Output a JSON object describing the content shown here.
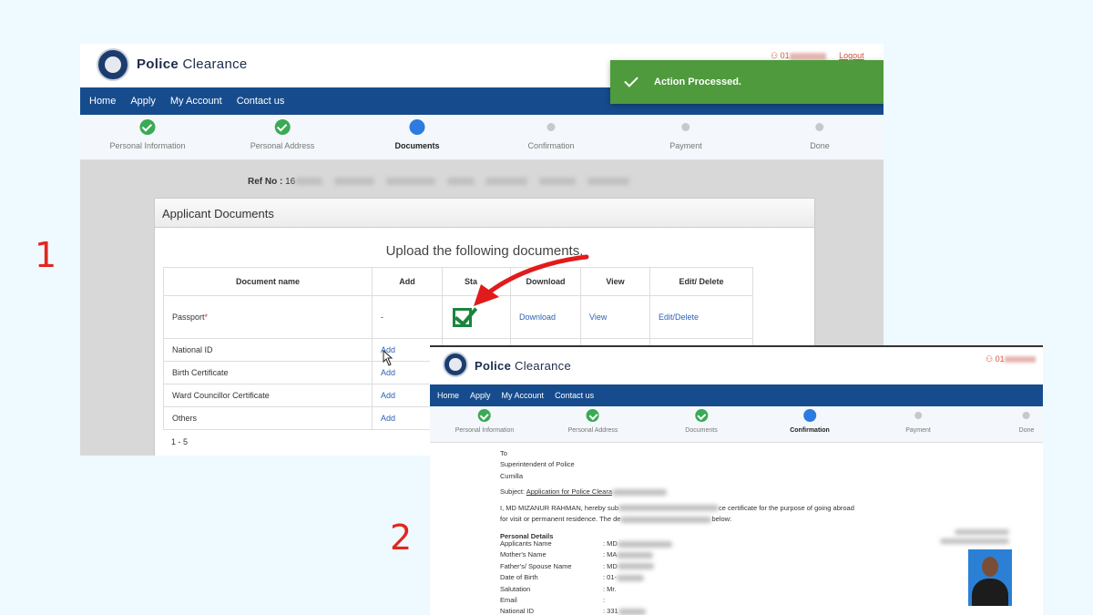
{
  "labels": {
    "one": "1",
    "two": "2"
  },
  "shot1": {
    "brand_bold": "Police",
    "brand_rest": " Clearance",
    "user_prefix": "01",
    "logout": "Logout",
    "nav": [
      "Home",
      "Apply",
      "My Account",
      "Contact us"
    ],
    "steps": [
      "Personal Information",
      "Personal Address",
      "Documents",
      "Confirmation",
      "Payment",
      "Done"
    ],
    "toast": "Action Processed.",
    "ref_label": "Ref No :",
    "ref_value": "16",
    "panel_title": "Applicant Documents",
    "upload_title": "Upload the following documents.",
    "headers": [
      "Document name",
      "Add",
      "Status",
      "Download",
      "View",
      "Edit/ Delete"
    ],
    "header_status_visible": "Sta",
    "rows": [
      {
        "name": "Passport",
        "required": "*",
        "add": "-",
        "download": "Download",
        "view": "View",
        "edit": "Edit/Delete"
      },
      {
        "name": "National ID",
        "add": "Add"
      },
      {
        "name": "Birth Certificate",
        "add": "Add"
      },
      {
        "name": "Ward Councillor Certificate",
        "add": "Add"
      },
      {
        "name": "Others",
        "add": "Add"
      }
    ],
    "pager": "1 - 5"
  },
  "shot2": {
    "brand_bold": "Police",
    "brand_rest": " Clearance",
    "user_prefix": "01",
    "nav": [
      "Home",
      "Apply",
      "My Account",
      "Contact us"
    ],
    "steps": [
      "Personal Information",
      "Personal Address",
      "Documents",
      "Confirmation",
      "Payment",
      "Done"
    ],
    "to": "To",
    "addressee": "Superintendent of Police",
    "district": "Cumilla",
    "subject_label": "Subject:",
    "subject_value": "Application for Police Cleara",
    "body_line1_a": "I, MD MIZANUR RAHMAN, hereby sub",
    "body_line1_b": "ce certificate for the purpose of going abroad",
    "body_line2_a": "for visit or permanent residence. The de",
    "body_line2_b": "below:",
    "section": "Personal Details",
    "fields": [
      {
        "label": "Applicants Name",
        "value": "MD"
      },
      {
        "label": "Mother's Name",
        "value": "MA"
      },
      {
        "label": "Father's/ Spouse Name",
        "value": "MD"
      },
      {
        "label": "Date of Birth",
        "value": "01-"
      },
      {
        "label": "Salutation",
        "value": "Mr."
      },
      {
        "label": "Email",
        "value": ""
      },
      {
        "label": "National ID",
        "value": "331"
      }
    ]
  },
  "colors": {
    "accent": "#e3261f",
    "nav": "#164c8d",
    "toast": "#4e9a3c",
    "done": "#3aaa55",
    "current": "#2d7be0"
  },
  "icons": [
    "user-icon",
    "check-icon",
    "status-checkbox-icon",
    "red-arrow-icon",
    "mouse-cursor-icon",
    "applicant-photo"
  ]
}
